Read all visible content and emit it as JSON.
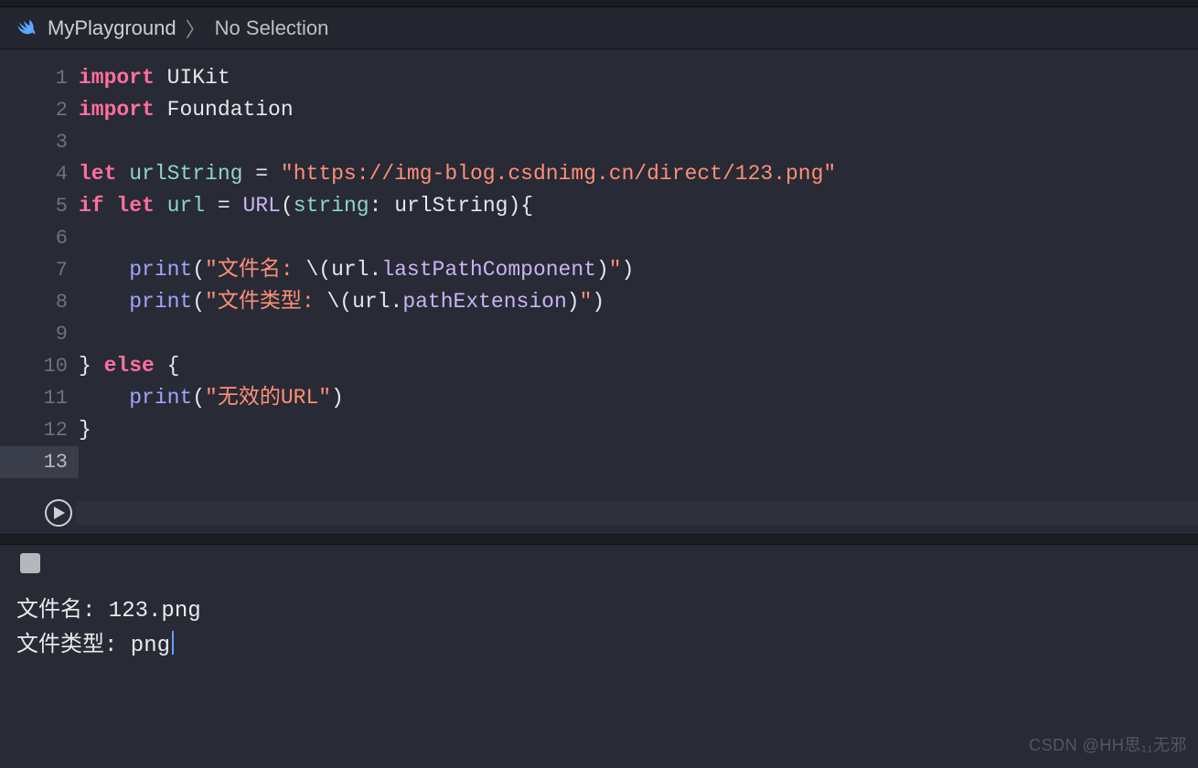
{
  "breadcrumb": {
    "file": "MyPlayground",
    "selection": "No Selection"
  },
  "code": {
    "lines": [
      {
        "n": 1,
        "tokens": [
          [
            "kw",
            "import"
          ],
          [
            "sp",
            " "
          ],
          [
            "type",
            "UIKit"
          ]
        ]
      },
      {
        "n": 2,
        "tokens": [
          [
            "kw",
            "import"
          ],
          [
            "sp",
            " "
          ],
          [
            "type",
            "Foundation"
          ]
        ]
      },
      {
        "n": 3,
        "tokens": []
      },
      {
        "n": 4,
        "tokens": [
          [
            "kw",
            "let"
          ],
          [
            "sp",
            " "
          ],
          [
            "decl",
            "urlString"
          ],
          [
            "sp",
            " "
          ],
          [
            "punc",
            "="
          ],
          [
            "sp",
            " "
          ],
          [
            "str",
            "\"https://img-blog.csdnimg.cn/direct/123.png\""
          ]
        ]
      },
      {
        "n": 5,
        "tokens": [
          [
            "kw",
            "if"
          ],
          [
            "sp",
            " "
          ],
          [
            "kw",
            "let"
          ],
          [
            "sp",
            " "
          ],
          [
            "decl",
            "url"
          ],
          [
            "sp",
            " "
          ],
          [
            "punc",
            "="
          ],
          [
            "sp",
            " "
          ],
          [
            "cls",
            "URL"
          ],
          [
            "punc",
            "("
          ],
          [
            "arg",
            "string"
          ],
          [
            "punc",
            ":"
          ],
          [
            "sp",
            " "
          ],
          [
            "id",
            "urlString"
          ],
          [
            "punc",
            "){"
          ]
        ]
      },
      {
        "n": 6,
        "tokens": [
          [
            "sp",
            "    "
          ]
        ]
      },
      {
        "n": 7,
        "tokens": [
          [
            "sp",
            "    "
          ],
          [
            "fn",
            "print"
          ],
          [
            "punc",
            "("
          ],
          [
            "str",
            "\"文件名: "
          ],
          [
            "punc",
            "\\("
          ],
          [
            "id",
            "url"
          ],
          [
            "punc",
            "."
          ],
          [
            "prop",
            "lastPathComponent"
          ],
          [
            "punc",
            ")"
          ],
          [
            "str",
            "\""
          ],
          [
            "punc",
            ")"
          ]
        ]
      },
      {
        "n": 8,
        "tokens": [
          [
            "sp",
            "    "
          ],
          [
            "fn",
            "print"
          ],
          [
            "punc",
            "("
          ],
          [
            "str",
            "\"文件类型: "
          ],
          [
            "punc",
            "\\("
          ],
          [
            "id",
            "url"
          ],
          [
            "punc",
            "."
          ],
          [
            "prop",
            "pathExtension"
          ],
          [
            "punc",
            ")"
          ],
          [
            "str",
            "\""
          ],
          [
            "punc",
            ")"
          ]
        ]
      },
      {
        "n": 9,
        "tokens": [
          [
            "sp",
            "    "
          ]
        ]
      },
      {
        "n": 10,
        "tokens": [
          [
            "punc",
            "}"
          ],
          [
            "sp",
            " "
          ],
          [
            "kw",
            "else"
          ],
          [
            "sp",
            " "
          ],
          [
            "punc",
            "{"
          ]
        ]
      },
      {
        "n": 11,
        "tokens": [
          [
            "sp",
            "    "
          ],
          [
            "fn",
            "print"
          ],
          [
            "punc",
            "("
          ],
          [
            "str",
            "\"无效的URL\""
          ],
          [
            "punc",
            ")"
          ]
        ]
      },
      {
        "n": 12,
        "tokens": [
          [
            "punc",
            "}"
          ]
        ]
      },
      {
        "n": 13,
        "tokens": [],
        "boxed": true
      }
    ]
  },
  "console": {
    "lines": [
      "文件名: 123.png",
      "文件类型: png"
    ]
  },
  "watermark": "CSDN @HH思₁₁无邪"
}
